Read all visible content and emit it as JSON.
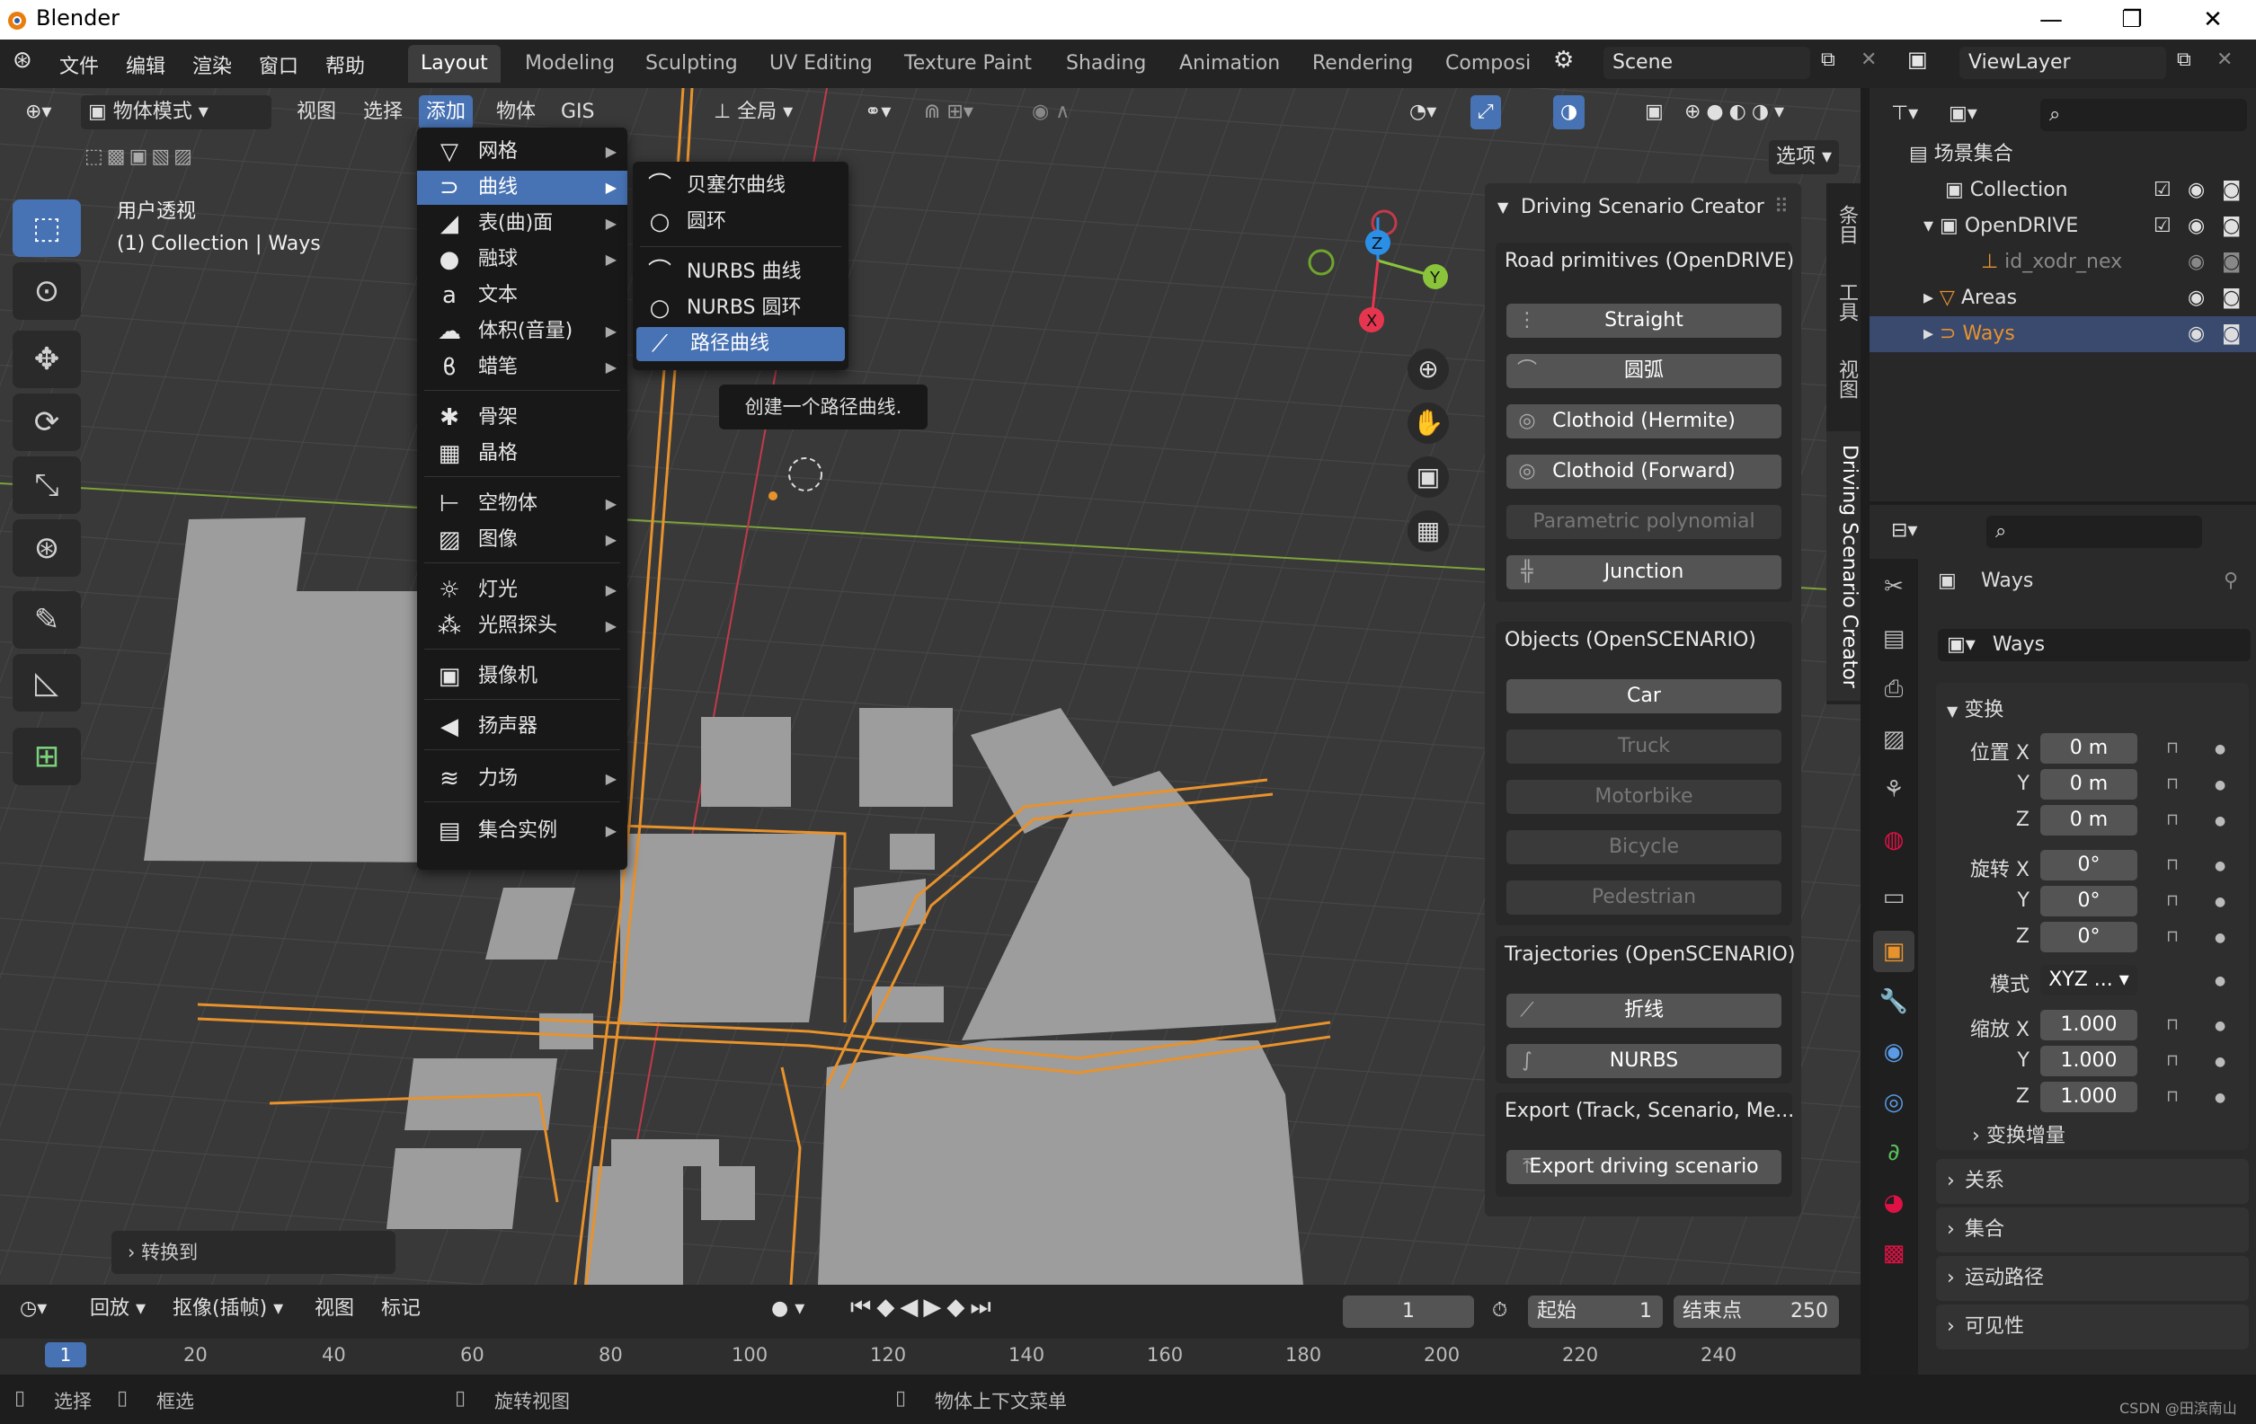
{
  "titlebar": {
    "title": "Blender",
    "minimize": "—",
    "maximize": "❐",
    "close": "✕"
  },
  "menubar": {
    "items": [
      "文件",
      "编辑",
      "渲染",
      "窗口",
      "帮助"
    ]
  },
  "workspaces": [
    "Layout",
    "Modeling",
    "Sculpting",
    "UV Editing",
    "Texture Paint",
    "Shading",
    "Animation",
    "Rendering",
    "Composi"
  ],
  "scene": {
    "name": "Scene",
    "viewlayer": "ViewLayer"
  },
  "viewport_header": {
    "mode": "物体模式",
    "items": [
      "视图",
      "选择",
      "添加",
      "物体",
      "GIS"
    ],
    "transform": "全局",
    "options": "选项"
  },
  "viewport_info": {
    "line1": "用户透视",
    "line2": "(1) Collection | Ways"
  },
  "add_menu": {
    "items": [
      {
        "label": "网格",
        "icon": "▽"
      },
      {
        "label": "曲线",
        "icon": "⊃"
      },
      {
        "label": "表(曲)面",
        "icon": "◢"
      },
      {
        "label": "融球",
        "icon": "●"
      },
      {
        "label": "文本",
        "icon": "a"
      },
      {
        "label": "体积(音量)",
        "icon": "☁"
      },
      {
        "label": "蜡笔",
        "icon": "ϐ"
      },
      {
        "label": "骨架",
        "icon": "✱"
      },
      {
        "label": "晶格",
        "icon": "▦"
      },
      {
        "label": "空物体",
        "icon": "⊢"
      },
      {
        "label": "图像",
        "icon": "▨"
      },
      {
        "label": "灯光",
        "icon": "☼"
      },
      {
        "label": "光照探头",
        "icon": "⁂"
      },
      {
        "label": "摄像机",
        "icon": "▣"
      },
      {
        "label": "扬声器",
        "icon": "◀"
      },
      {
        "label": "力场",
        "icon": "≋"
      },
      {
        "label": "集合实例",
        "icon": "▤"
      }
    ]
  },
  "curve_submenu": {
    "items": [
      {
        "label": "贝塞尔曲线",
        "icon": "⌒"
      },
      {
        "label": "圆环",
        "icon": "○"
      },
      {
        "label": "NURBS 曲线",
        "icon": "⌒"
      },
      {
        "label": "NURBS 圆环",
        "icon": "○"
      },
      {
        "label": "路径曲线",
        "icon": "⟋"
      }
    ]
  },
  "tooltip": "创建一个路径曲线.",
  "dsc_panel": {
    "title": "Driving Scenario Creator",
    "road_title": "Road primitives (OpenDRIVE)",
    "road_buttons": [
      "Straight",
      "圆弧",
      "Clothoid (Hermite)",
      "Clothoid (Forward)",
      "Parametric polynomial",
      "Junction"
    ],
    "objects_title": "Objects (OpenSCENARIO)",
    "object_buttons": [
      "Car",
      "Truck",
      "Motorbike",
      "Bicycle",
      "Pedestrian"
    ],
    "traj_title": "Trajectories (OpenSCENARIO)",
    "traj_buttons": [
      "折线",
      "NURBS"
    ],
    "export_title": "Export (Track, Scenario, Me...",
    "export_button": "Export driving scenario"
  },
  "side_tabs": [
    "条目",
    "工具",
    "视图",
    "Driving Scenario Creator"
  ],
  "redo_panel": "转换到",
  "outliner": {
    "root": "场景集合",
    "rows": [
      {
        "label": "Collection"
      },
      {
        "label": "OpenDRIVE"
      },
      {
        "label": "id_xodr_nex"
      },
      {
        "label": "Areas"
      },
      {
        "label": "Ways"
      }
    ]
  },
  "properties": {
    "object_name": "Ways",
    "data_name": "Ways",
    "transform_title": "变换",
    "location_label": "位置 X",
    "rotation_label": "旋转 X",
    "scale_label": "缩放 X",
    "axis_y": "Y",
    "axis_z": "Z",
    "mode_label": "模式",
    "mode_value": "XYZ ...",
    "loc": [
      "0 m",
      "0 m",
      "0 m"
    ],
    "rot": [
      "0°",
      "0°",
      "0°"
    ],
    "scale": [
      "1.000",
      "1.000",
      "1.000"
    ],
    "delta": "变换增量",
    "sections": [
      "关系",
      "集合",
      "运动路径",
      "可见性"
    ]
  },
  "timeline": {
    "menus": [
      "回放",
      "抠像(插帧)",
      "视图",
      "标记"
    ],
    "current": "1",
    "start_label": "起始",
    "start": "1",
    "end_label": "结束点",
    "end": "250",
    "ruler": [
      "1",
      "20",
      "40",
      "60",
      "80",
      "100",
      "120",
      "140",
      "160",
      "180",
      "200",
      "220",
      "240"
    ]
  },
  "statusbar": {
    "items": [
      "选择",
      "框选",
      "旋转视图",
      "物体上下文菜单"
    ],
    "watermark": "CSDN @田滨南山"
  },
  "colors": {
    "accent": "#4772b3",
    "road": "#e8922c",
    "building": "#9d9d9d"
  }
}
